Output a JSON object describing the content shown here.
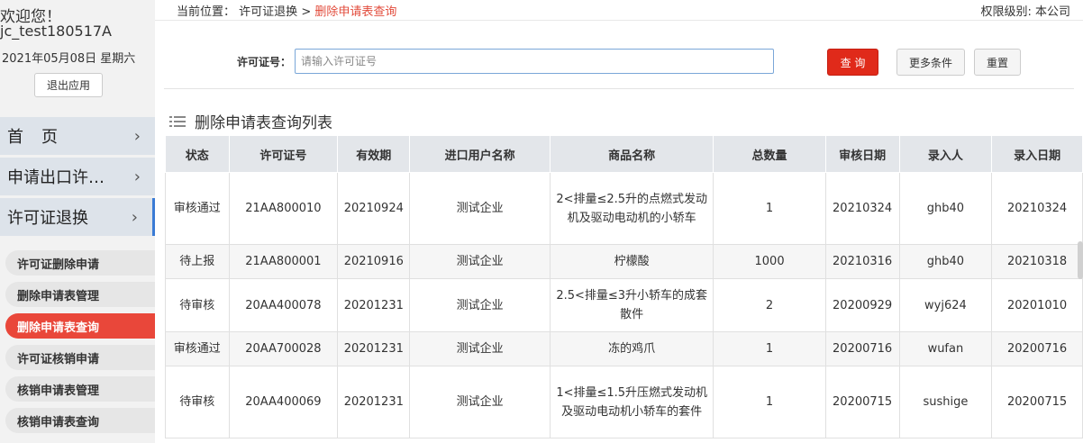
{
  "sidebar": {
    "welcome": "欢迎您！",
    "username": "jc_test180517A",
    "date": "2021年05月08日 星期六",
    "logout_label": "退出应用",
    "nav": [
      {
        "label": "首页",
        "chevron": "›"
      },
      {
        "label": "申请出口许…",
        "chevron": "›"
      },
      {
        "label": "许可证退换",
        "chevron": "›"
      }
    ],
    "sub_items": [
      {
        "label": "许可证删除申请"
      },
      {
        "label": "删除申请表管理"
      },
      {
        "label": "删除申请表查询"
      },
      {
        "label": "许可证核销申请"
      },
      {
        "label": "核销申请表管理"
      },
      {
        "label": "核销申请表查询"
      }
    ]
  },
  "breadcrumb": {
    "prefix": "当前位置：",
    "parent": "许可证退换",
    "separator": ">",
    "current": "删除申请表查询"
  },
  "permission": "权限级别: 本公司",
  "search": {
    "label": "许可证号：",
    "placeholder": "请输入许可证号",
    "value": "",
    "query_label": "查 询",
    "more_label": "更多条件",
    "reset_label": "重置"
  },
  "list": {
    "title": "删除申请表查询列表",
    "columns": [
      "状态",
      "许可证号",
      "有效期",
      "进口用户名称",
      "商品名称",
      "总数量",
      "审核日期",
      "录入人",
      "录入日期"
    ],
    "rows": [
      [
        "审核通过",
        "21AA800010",
        "20210924",
        "测试企业",
        "2<排量≤2.5升的点燃式发动机及驱动电动机的小轿车",
        "1",
        "20210324",
        "ghb40",
        "20210324"
      ],
      [
        "待上报",
        "21AA800001",
        "20210916",
        "测试企业",
        "柠檬酸",
        "1000",
        "20210316",
        "ghb40",
        "20210318"
      ],
      [
        "待审核",
        "20AA400078",
        "20201231",
        "测试企业",
        "2.5<排量≤3升小轿车的成套散件",
        "2",
        "20200929",
        "wyj624",
        "20201010"
      ],
      [
        "审核通过",
        "20AA700028",
        "20201231",
        "测试企业",
        "冻的鸡爪",
        "1",
        "20200716",
        "wufan",
        "20200716"
      ],
      [
        "待审核",
        "20AA400069",
        "20201231",
        "测试企业",
        "1<排量≤1.5升压燃式发动机及驱动电动机小轿车的套件",
        "1",
        "20200715",
        "sushige",
        "20200715"
      ]
    ]
  }
}
